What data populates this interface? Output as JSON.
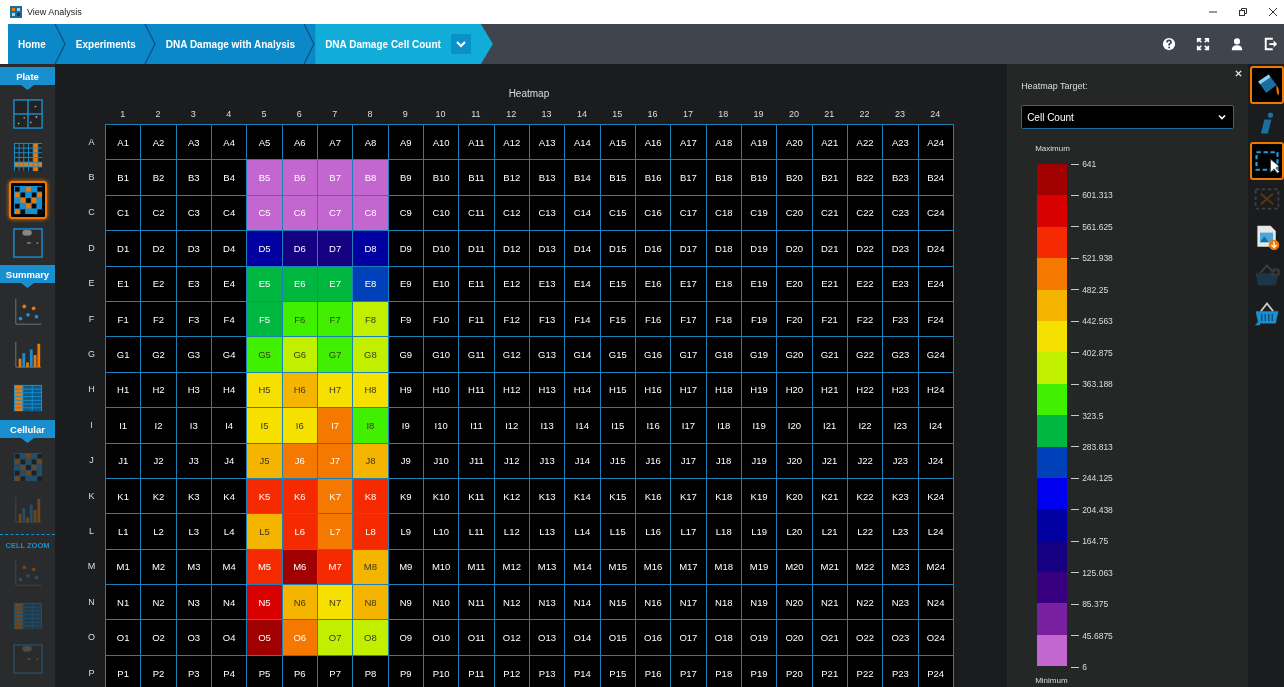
{
  "window": {
    "title": "View Analysis"
  },
  "breadcrumbs": [
    {
      "label": "Home",
      "selected": false
    },
    {
      "label": "Experiments",
      "selected": false
    },
    {
      "label": "DNA Damage with Analysis",
      "selected": false
    },
    {
      "label": "DNA Damage Cell Count",
      "selected": true
    }
  ],
  "sidebar": {
    "sections": [
      {
        "title": "Plate",
        "kind": "tab",
        "items": [
          {
            "kind": "quadrants",
            "selected": false,
            "disabled": false
          },
          {
            "kind": "grid",
            "selected": false,
            "disabled": false
          },
          {
            "kind": "heatmap",
            "selected": true,
            "disabled": false
          },
          {
            "kind": "wells",
            "selected": false,
            "disabled": false
          }
        ]
      },
      {
        "title": "Summary",
        "kind": "tab",
        "items": [
          {
            "kind": "scatter",
            "selected": false,
            "disabled": false
          },
          {
            "kind": "bar",
            "selected": false,
            "disabled": false
          },
          {
            "kind": "table",
            "selected": false,
            "disabled": false
          }
        ]
      },
      {
        "title": "Cellular",
        "kind": "tab",
        "items": [
          {
            "kind": "heatmap",
            "selected": false,
            "disabled": true
          },
          {
            "kind": "bar",
            "selected": false,
            "disabled": true
          }
        ]
      },
      {
        "title": "CELL ZOOM",
        "kind": "label",
        "items": [
          {
            "kind": "scatter",
            "selected": false,
            "disabled": true
          },
          {
            "kind": "table",
            "selected": false,
            "disabled": true
          },
          {
            "kind": "wells",
            "selected": false,
            "disabled": true
          }
        ]
      }
    ]
  },
  "heatmap": {
    "title": "Heatmap",
    "columns": [
      "1",
      "2",
      "3",
      "4",
      "5",
      "6",
      "7",
      "8",
      "9",
      "10",
      "11",
      "12",
      "13",
      "14",
      "15",
      "16",
      "17",
      "18",
      "19",
      "20",
      "21",
      "22",
      "23",
      "24"
    ],
    "rows": [
      {
        "label": "A",
        "cells": [
          "A1",
          "A2",
          "A3",
          "A4",
          "A5",
          "A6",
          "A7",
          "A8",
          "A9",
          "A10",
          "A11",
          "A12",
          "A13",
          "A14",
          "A15",
          "A16",
          "A17",
          "A18",
          "A19",
          "A20",
          "A21",
          "A22",
          "A23",
          "A24"
        ]
      },
      {
        "label": "B",
        "cells": [
          "B1",
          "B2",
          "B3",
          "B4",
          {
            "text": "B5",
            "color": "#c466d0"
          },
          {
            "text": "B6",
            "color": "#c466d0"
          },
          {
            "text": "B7",
            "color": "#c466d0"
          },
          {
            "text": "B8",
            "color": "#c466d0"
          },
          "B9",
          "B10",
          "B11",
          "B12",
          "B13",
          "B14",
          "B15",
          "B16",
          "B17",
          "B18",
          "B19",
          "B20",
          "B21",
          "B22",
          "B23",
          "B24"
        ]
      },
      {
        "label": "C",
        "cells": [
          "C1",
          "C2",
          "C3",
          "C4",
          {
            "text": "C5",
            "color": "#c466d0"
          },
          {
            "text": "C6",
            "color": "#c466d0"
          },
          {
            "text": "C7",
            "color": "#c466d0"
          },
          {
            "text": "C8",
            "color": "#c466d0"
          },
          "C9",
          "C10",
          "C11",
          "C12",
          "C13",
          "C14",
          "C15",
          "C16",
          "C17",
          "C18",
          "C19",
          "C20",
          "C21",
          "C22",
          "C23",
          "C24"
        ]
      },
      {
        "label": "D",
        "cells": [
          "D1",
          "D2",
          "D3",
          "D4",
          {
            "text": "D5",
            "color": "#0000a0"
          },
          {
            "text": "D6",
            "color": "#140080"
          },
          {
            "text": "D7",
            "color": "#140080"
          },
          {
            "text": "D8",
            "color": "#0000a0"
          },
          "D9",
          "D10",
          "D11",
          "D12",
          "D13",
          "D14",
          "D15",
          "D16",
          "D17",
          "D18",
          "D19",
          "D20",
          "D21",
          "D22",
          "D23",
          "D24"
        ]
      },
      {
        "label": "E",
        "cells": [
          "E1",
          "E2",
          "E3",
          "E4",
          {
            "text": "E5",
            "color": "#00b840"
          },
          {
            "text": "E6",
            "color": "#00b840"
          },
          {
            "text": "E7",
            "color": "#00b840"
          },
          {
            "text": "E8",
            "color": "#0040b8"
          },
          "E9",
          "E10",
          "E11",
          "E12",
          "E13",
          "E14",
          "E15",
          "E16",
          "E17",
          "E18",
          "E19",
          "E20",
          "E21",
          "E22",
          "E23",
          "E24"
        ]
      },
      {
        "label": "F",
        "cells": [
          "F1",
          "F2",
          "F3",
          "F4",
          {
            "text": "F5",
            "color": "#00b840"
          },
          {
            "text": "F6",
            "color": "#40f000"
          },
          {
            "text": "F7",
            "color": "#40f000"
          },
          {
            "text": "F8",
            "color": "#c0f000"
          },
          "F9",
          "F10",
          "F11",
          "F12",
          "F13",
          "F14",
          "F15",
          "F16",
          "F17",
          "F18",
          "F19",
          "F20",
          "F21",
          "F22",
          "F23",
          "F24"
        ]
      },
      {
        "label": "G",
        "cells": [
          "G1",
          "G2",
          "G3",
          "G4",
          {
            "text": "G5",
            "color": "#40f000"
          },
          {
            "text": "G6",
            "color": "#c0f000"
          },
          {
            "text": "G7",
            "color": "#40f000"
          },
          {
            "text": "G8",
            "color": "#c0f000"
          },
          "G9",
          "G10",
          "G11",
          "G12",
          "G13",
          "G14",
          "G15",
          "G16",
          "G17",
          "G18",
          "G19",
          "G20",
          "G21",
          "G22",
          "G23",
          "G24"
        ]
      },
      {
        "label": "H",
        "cells": [
          "H1",
          "H2",
          "H3",
          "H4",
          {
            "text": "H5",
            "color": "#f5e000"
          },
          {
            "text": "H6",
            "color": "#f5b400"
          },
          {
            "text": "H7",
            "color": "#f5e000"
          },
          {
            "text": "H8",
            "color": "#f5e000"
          },
          "H9",
          "H10",
          "H11",
          "H12",
          "H13",
          "H14",
          "H15",
          "H16",
          "H17",
          "H18",
          "H19",
          "H20",
          "H21",
          "H22",
          "H23",
          "H24"
        ]
      },
      {
        "label": "I",
        "cells": [
          "I1",
          "I2",
          "I3",
          "I4",
          {
            "text": "I5",
            "color": "#f5e000"
          },
          {
            "text": "I6",
            "color": "#f5e000"
          },
          {
            "text": "I7",
            "color": "#f57800"
          },
          {
            "text": "I8",
            "color": "#40f000"
          },
          "I9",
          "I10",
          "I11",
          "I12",
          "I13",
          "I14",
          "I15",
          "I16",
          "I17",
          "I18",
          "I19",
          "I20",
          "I21",
          "I22",
          "I23",
          "I24"
        ]
      },
      {
        "label": "J",
        "cells": [
          "J1",
          "J2",
          "J3",
          "J4",
          {
            "text": "J5",
            "color": "#f5b400"
          },
          {
            "text": "J6",
            "color": "#f57800"
          },
          {
            "text": "J7",
            "color": "#f57800"
          },
          {
            "text": "J8",
            "color": "#f5b400"
          },
          "J9",
          "J10",
          "J11",
          "J12",
          "J13",
          "J14",
          "J15",
          "J16",
          "J17",
          "J18",
          "J19",
          "J20",
          "J21",
          "J22",
          "J23",
          "J24"
        ]
      },
      {
        "label": "K",
        "cells": [
          "K1",
          "K2",
          "K3",
          "K4",
          {
            "text": "K5",
            "color": "#f52a00"
          },
          {
            "text": "K6",
            "color": "#f52a00"
          },
          {
            "text": "K7",
            "color": "#f57800"
          },
          {
            "text": "K8",
            "color": "#f52a00"
          },
          "K9",
          "K10",
          "K11",
          "K12",
          "K13",
          "K14",
          "K15",
          "K16",
          "K17",
          "K18",
          "K19",
          "K20",
          "K21",
          "K22",
          "K23",
          "K24"
        ]
      },
      {
        "label": "L",
        "cells": [
          "L1",
          "L2",
          "L3",
          "L4",
          {
            "text": "L5",
            "color": "#f5b400"
          },
          {
            "text": "L6",
            "color": "#f52a00"
          },
          {
            "text": "L7",
            "color": "#f57800"
          },
          {
            "text": "L8",
            "color": "#f52a00"
          },
          "L9",
          "L10",
          "L11",
          "L12",
          "L13",
          "L14",
          "L15",
          "L16",
          "L17",
          "L18",
          "L19",
          "L20",
          "L21",
          "L22",
          "L23",
          "L24"
        ]
      },
      {
        "label": "M",
        "cells": [
          "M1",
          "M2",
          "M3",
          "M4",
          {
            "text": "M5",
            "color": "#f52a00"
          },
          {
            "text": "M6",
            "color": "#a00000"
          },
          {
            "text": "M7",
            "color": "#f52a00"
          },
          {
            "text": "M8",
            "color": "#f5b400"
          },
          "M9",
          "M10",
          "M11",
          "M12",
          "M13",
          "M14",
          "M15",
          "M16",
          "M17",
          "M18",
          "M19",
          "M20",
          "M21",
          "M22",
          "M23",
          "M24"
        ]
      },
      {
        "label": "N",
        "cells": [
          "N1",
          "N2",
          "N3",
          "N4",
          {
            "text": "N5",
            "color": "#d80000"
          },
          {
            "text": "N6",
            "color": "#f5b400"
          },
          {
            "text": "N7",
            "color": "#f5e000"
          },
          {
            "text": "N8",
            "color": "#f5b400"
          },
          "N9",
          "N10",
          "N11",
          "N12",
          "N13",
          "N14",
          "N15",
          "N16",
          "N17",
          "N18",
          "N19",
          "N20",
          "N21",
          "N22",
          "N23",
          "N24"
        ]
      },
      {
        "label": "O",
        "cells": [
          "O1",
          "O2",
          "O3",
          "O4",
          {
            "text": "O5",
            "color": "#a00000"
          },
          {
            "text": "O6",
            "color": "#f57800"
          },
          {
            "text": "O7",
            "color": "#c0f000"
          },
          {
            "text": "O8",
            "color": "#c0f000"
          },
          "O9",
          "O10",
          "O11",
          "O12",
          "O13",
          "O14",
          "O15",
          "O16",
          "O17",
          "O18",
          "O19",
          "O20",
          "O21",
          "O22",
          "O23",
          "O24"
        ]
      },
      {
        "label": "P",
        "cells": [
          "P1",
          "P2",
          "P3",
          "P4",
          "P5",
          "P6",
          "P7",
          "P8",
          "P9",
          "P10",
          "P11",
          "P12",
          "P13",
          "P14",
          "P15",
          "P16",
          "P17",
          "P18",
          "P19",
          "P20",
          "P21",
          "P22",
          "P23",
          "P24"
        ]
      }
    ]
  },
  "panel": {
    "target_label": "Heatmap Target:",
    "target_value": "Cell Count",
    "legend": {
      "max_label": "Maximum",
      "min_label": "Minimum",
      "bins": [
        {
          "color": "#a00000"
        },
        {
          "color": "#d80000"
        },
        {
          "color": "#f52a00"
        },
        {
          "color": "#f57800"
        },
        {
          "color": "#f5b400"
        },
        {
          "color": "#f5e000"
        },
        {
          "color": "#c0f000"
        },
        {
          "color": "#40f000"
        },
        {
          "color": "#00b840"
        },
        {
          "color": "#0040b8"
        },
        {
          "color": "#0000f0"
        },
        {
          "color": "#0000a0"
        },
        {
          "color": "#140080"
        },
        {
          "color": "#380080"
        },
        {
          "color": "#7820a0"
        },
        {
          "color": "#c466d0"
        }
      ],
      "ticks": [
        "641",
        "601.313",
        "561.625",
        "521.938",
        "482.25",
        "442.563",
        "402.875",
        "363.188",
        "323.5",
        "283.813",
        "244.125",
        "204.438",
        "164.75",
        "125.063",
        "85.375",
        "45.6875",
        "6"
      ]
    }
  },
  "tools": [
    {
      "kind": "bucket",
      "selected": true,
      "disabled": false
    },
    {
      "kind": "info",
      "selected": false,
      "disabled": false
    },
    {
      "kind": "select",
      "selected": true,
      "disabled": false
    },
    {
      "kind": "clear-select",
      "selected": false,
      "disabled": true
    },
    {
      "kind": "export-image",
      "selected": false,
      "disabled": false
    },
    {
      "kind": "basket-add",
      "selected": false,
      "disabled": true
    },
    {
      "kind": "basket",
      "selected": false,
      "disabled": false
    }
  ]
}
